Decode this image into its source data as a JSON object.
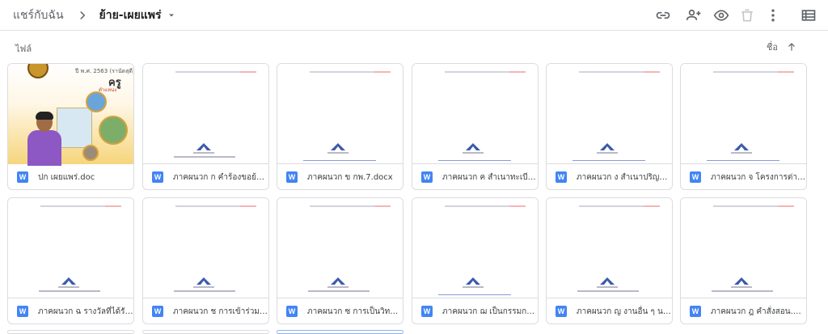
{
  "breadcrumb": {
    "root": "แชร์กับฉัน",
    "current": "ย้าย-เผยแพร่"
  },
  "toolbar": {
    "icons": [
      "link-icon",
      "add-person-icon",
      "preview-icon",
      "delete-icon",
      "more-vert-icon",
      "list-view-icon"
    ]
  },
  "section": {
    "title": "ไฟล์",
    "sort_label": "ชื่อ"
  },
  "cover": {
    "year_text": "ปี พ.ศ. 2563 (รานัดสุดี)",
    "kru_text": "ครู",
    "sub_text": "ตำแหน่ง"
  },
  "files": [
    {
      "name": "ปก เผยแพร่.doc",
      "type": "W",
      "thumb": "cover"
    },
    {
      "name": "ภาคผนวก ก คำร้องขอย้าย.d...",
      "type": "W",
      "thumb": "doc"
    },
    {
      "name": "ภาคผนวก ข กพ.7.docx",
      "type": "W",
      "thumb": "doc"
    },
    {
      "name": "ภาคผนวก ค สำเนาทะเบียนบ้...",
      "type": "W",
      "thumb": "doc"
    },
    {
      "name": "ภาคผนวก ง สำเนาปริญญาบั...",
      "type": "W",
      "thumb": "doc"
    },
    {
      "name": "ภาคผนวก จ โครงการต่าง ๆ...",
      "type": "W",
      "thumb": "doc"
    },
    {
      "name": "ภาคผนวก ฉ รางวัลที่ได้รับ.d...",
      "type": "W",
      "thumb": "doc"
    },
    {
      "name": "ภาคผนวก ช การเข้าร่วมอบร...",
      "type": "W",
      "thumb": "doc"
    },
    {
      "name": "ภาคผนวก ซ การเป็นวิทยากร...",
      "type": "W",
      "thumb": "doc"
    },
    {
      "name": "ภาคผนวก ฌ เป็นกรรมการต่า...",
      "type": "W",
      "thumb": "doc"
    },
    {
      "name": "ภาคผนวก ญ งานอื่น ๆ นอกจ...",
      "type": "W",
      "thumb": "doc"
    },
    {
      "name": "ภาคผนวก ฎ คำสั่งสอน.docx",
      "type": "W",
      "thumb": "doc"
    }
  ],
  "colors": {
    "word_blue": "#4285f4",
    "card_border": "#dadce0",
    "selected_border": "#8ab4f8"
  }
}
